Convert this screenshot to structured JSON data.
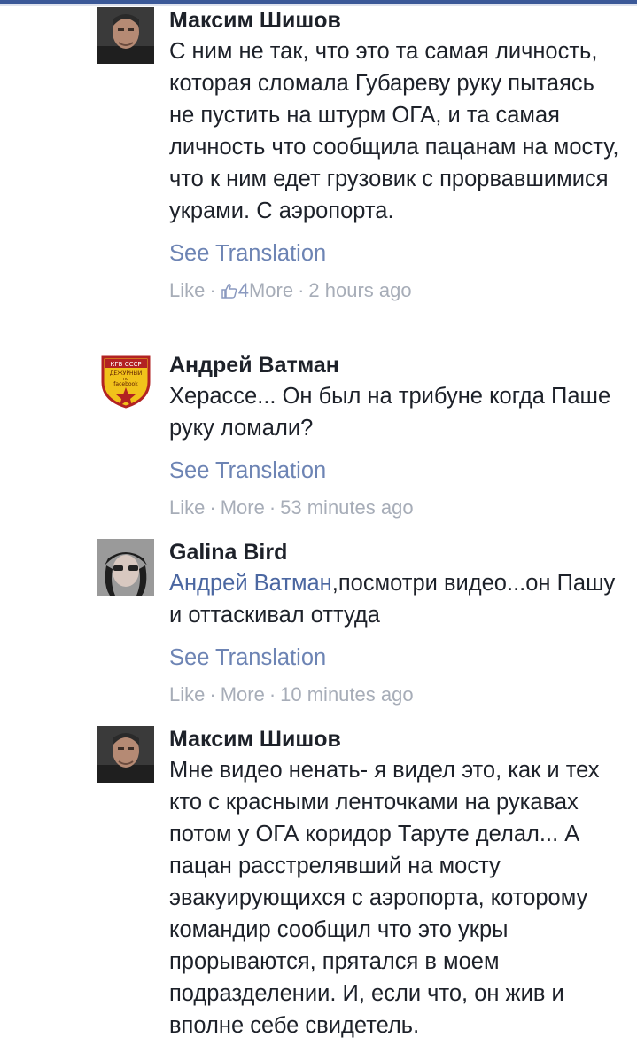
{
  "comments": [
    {
      "author": "Максим Шишов",
      "text": "С ним не так, что это та самая личность, которая сломала Губареву руку пытаясь не пустить на штурм ОГА, и та самая личность что сообщила пацанам на мосту, что к ним едет грузовик с прорвавшимися украми. С аэропорта.",
      "mention": "",
      "translation": "See Translation",
      "like": "Like",
      "likes_count": "4",
      "more": "More",
      "time": "2 hours ago",
      "avatar_icon": "man-portrait-avatar"
    },
    {
      "author": "Андрей Ватман",
      "text": "Херассе... Он был на трибуне когда Паше руку ломали?",
      "mention": "",
      "translation": "See Translation",
      "like": "Like",
      "more": "More",
      "time": "53 minutes ago",
      "avatar_icon": "badge-shield-avatar",
      "badge_lines": [
        "КГБ СССР",
        "ДЕЖУРНЫЙ",
        "по",
        "facebook"
      ]
    },
    {
      "author": "Galina Bird",
      "mention": "Андрей Ватман",
      "text": ",посмотри видео...он Пашу и оттаскивал оттуда",
      "translation": "See Translation",
      "like": "Like",
      "more": "More",
      "time": "10 minutes ago",
      "avatar_icon": "woman-portrait-avatar"
    },
    {
      "author": "Максим Шишов",
      "text": "Мне видео ненать- я видел это, как и тех кто с красными ленточками на рукавах потом у ОГА коридор Таруте делал... А пацан расстрелявший на мосту эвакуирующихся с аэропорта, которому командир сообщил что это укры прорываются, прятался в моем подразделении. И, если что, он жив и вполне себе свидетель.",
      "mention": "",
      "avatar_icon": "man-portrait-avatar"
    }
  ],
  "colors": {
    "header_bar": "#3b5998",
    "author": "#1d2129",
    "link": "#6d84b4",
    "meta": "#a7adb8"
  }
}
